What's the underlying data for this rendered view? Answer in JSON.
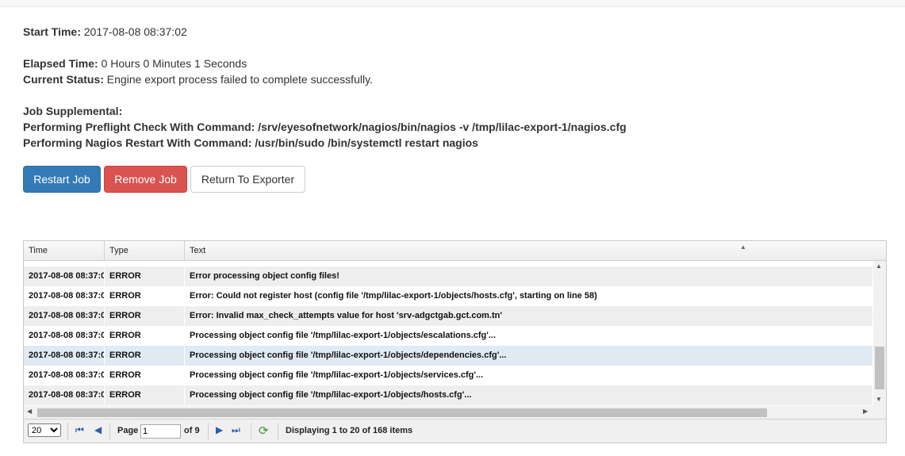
{
  "job": {
    "start_label": "Start Time:",
    "start_value": "2017-08-08 08:37:02",
    "elapsed_label": "Elapsed Time:",
    "elapsed_value": "0 Hours 0 Minutes 1 Seconds",
    "status_label": "Current Status:",
    "status_value": "Engine export process failed to complete successfully.",
    "supplemental_label": "Job Supplemental:",
    "supplemental_lines": [
      "Performing Preflight Check With Command: /srv/eyesofnetwork/nagios/bin/nagios -v /tmp/lilac-export-1/nagios.cfg",
      "Performing Nagios Restart With Command: /usr/bin/sudo /bin/systemctl restart nagios"
    ]
  },
  "buttons": {
    "restart": "Restart Job",
    "remove": "Remove Job",
    "return": "Return To Exporter"
  },
  "grid": {
    "columns": [
      "Time",
      "Type",
      "Text"
    ],
    "rows": [
      {
        "time": "2017-08-08 08:37:0",
        "type": "ERROR",
        "text": "Error processing object config files!"
      },
      {
        "time": "2017-08-08 08:37:0",
        "type": "ERROR",
        "text": "Error: Could not register host (config file '/tmp/lilac-export-1/objects/hosts.cfg', starting on line 58)"
      },
      {
        "time": "2017-08-08 08:37:0",
        "type": "ERROR",
        "text": "Error: Invalid max_check_attempts value for host 'srv-adgctgab.gct.com.tn'"
      },
      {
        "time": "2017-08-08 08:37:0",
        "type": "ERROR",
        "text": "Processing object config file '/tmp/lilac-export-1/objects/escalations.cfg'..."
      },
      {
        "time": "2017-08-08 08:37:0",
        "type": "ERROR",
        "text": "Processing object config file '/tmp/lilac-export-1/objects/dependencies.cfg'..."
      },
      {
        "time": "2017-08-08 08:37:0",
        "type": "ERROR",
        "text": "Processing object config file '/tmp/lilac-export-1/objects/services.cfg'..."
      },
      {
        "time": "2017-08-08 08:37:0",
        "type": "ERROR",
        "text": "Processing object config file '/tmp/lilac-export-1/objects/hosts.cfg'..."
      }
    ],
    "selected_row": 4
  },
  "pager": {
    "page_size": "20",
    "page_label": "Page",
    "page_value": "1",
    "of_label": "of 9",
    "display_text": "Displaying 1 to 20 of 168 items"
  },
  "colors": {
    "primary": "#337ab7",
    "danger": "#d9534f",
    "selected_row": "#dfeaf3"
  }
}
